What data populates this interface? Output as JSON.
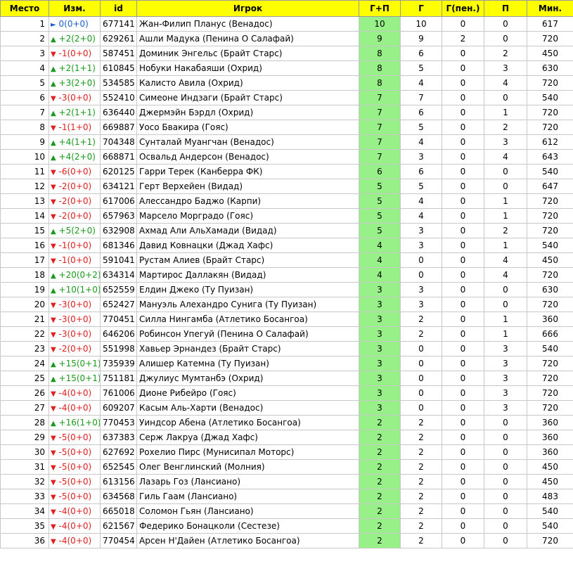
{
  "header": {
    "place": "Место",
    "change": "Изм.",
    "id": "id",
    "player": "Игрок",
    "gp": "Г+П",
    "g": "Г",
    "gpen": "Г(пен.)",
    "p": "П",
    "min": "Мин."
  },
  "colors": {
    "header_bg": "#ffff00",
    "gp_bg": "#98f088",
    "up": "#1a9a1a",
    "down": "#e02020",
    "same": "#1a5fd0"
  },
  "rows": [
    {
      "place": "1",
      "dir": "same",
      "arrow": "►",
      "change": "0(0+0)",
      "id": "677141",
      "player": "Жан-Филип Планус (Венадос)",
      "gp": "10",
      "g": "10",
      "gpen": "0",
      "p": "0",
      "min": "617"
    },
    {
      "place": "2",
      "dir": "up",
      "arrow": "▲",
      "change": "+2(2+0)",
      "id": "629261",
      "player": "Ашли Мадука (Пенина О Салафай)",
      "gp": "9",
      "g": "9",
      "gpen": "2",
      "p": "0",
      "min": "720"
    },
    {
      "place": "3",
      "dir": "down",
      "arrow": "▼",
      "change": "-1(0+0)",
      "id": "587451",
      "player": "Доминик Энгельс (Брайт Старс)",
      "gp": "8",
      "g": "6",
      "gpen": "0",
      "p": "2",
      "min": "450"
    },
    {
      "place": "4",
      "dir": "up",
      "arrow": "▲",
      "change": "+2(1+1)",
      "id": "610845",
      "player": "Нобуки Накабаяши (Охрид)",
      "gp": "8",
      "g": "5",
      "gpen": "0",
      "p": "3",
      "min": "630"
    },
    {
      "place": "5",
      "dir": "up",
      "arrow": "▲",
      "change": "+3(2+0)",
      "id": "534585",
      "player": "Калисто Авила (Охрид)",
      "gp": "8",
      "g": "4",
      "gpen": "0",
      "p": "4",
      "min": "720"
    },
    {
      "place": "6",
      "dir": "down",
      "arrow": "▼",
      "change": "-3(0+0)",
      "id": "552410",
      "player": "Симеоне Индзаги (Брайт Старс)",
      "gp": "7",
      "g": "7",
      "gpen": "0",
      "p": "0",
      "min": "540"
    },
    {
      "place": "7",
      "dir": "up",
      "arrow": "▲",
      "change": "+2(1+1)",
      "id": "636440",
      "player": "Джермэйн Бэрдл (Охрид)",
      "gp": "7",
      "g": "6",
      "gpen": "0",
      "p": "1",
      "min": "720"
    },
    {
      "place": "8",
      "dir": "down",
      "arrow": "▼",
      "change": "-1(1+0)",
      "id": "669887",
      "player": "Уосо Бвакира (Гояс)",
      "gp": "7",
      "g": "5",
      "gpen": "0",
      "p": "2",
      "min": "720"
    },
    {
      "place": "9",
      "dir": "up",
      "arrow": "▲",
      "change": "+4(1+1)",
      "id": "704348",
      "player": "Сунталай Муангчан (Венадос)",
      "gp": "7",
      "g": "4",
      "gpen": "0",
      "p": "3",
      "min": "612"
    },
    {
      "place": "10",
      "dir": "up",
      "arrow": "▲",
      "change": "+4(2+0)",
      "id": "668871",
      "player": "Освальд Андерсон (Венадос)",
      "gp": "7",
      "g": "3",
      "gpen": "0",
      "p": "4",
      "min": "643"
    },
    {
      "place": "11",
      "dir": "down",
      "arrow": "▼",
      "change": "-6(0+0)",
      "id": "620125",
      "player": "Гарри Терек (Канберра ФК)",
      "gp": "6",
      "g": "6",
      "gpen": "0",
      "p": "0",
      "min": "540"
    },
    {
      "place": "12",
      "dir": "down",
      "arrow": "▼",
      "change": "-2(0+0)",
      "id": "634121",
      "player": "Герт Верхейен (Видад)",
      "gp": "5",
      "g": "5",
      "gpen": "0",
      "p": "0",
      "min": "647"
    },
    {
      "place": "13",
      "dir": "down",
      "arrow": "▼",
      "change": "-2(0+0)",
      "id": "617006",
      "player": "Алессандро Баджо (Карпи)",
      "gp": "5",
      "g": "4",
      "gpen": "0",
      "p": "1",
      "min": "720"
    },
    {
      "place": "14",
      "dir": "down",
      "arrow": "▼",
      "change": "-2(0+0)",
      "id": "657963",
      "player": "Марсело Морградо (Гояс)",
      "gp": "5",
      "g": "4",
      "gpen": "0",
      "p": "1",
      "min": "720"
    },
    {
      "place": "15",
      "dir": "up",
      "arrow": "▲",
      "change": "+5(2+0)",
      "id": "632908",
      "player": "Ахмад Али АльХамади (Видад)",
      "gp": "5",
      "g": "3",
      "gpen": "0",
      "p": "2",
      "min": "720"
    },
    {
      "place": "16",
      "dir": "down",
      "arrow": "▼",
      "change": "-1(0+0)",
      "id": "681346",
      "player": "Давид Ковнацки (Джад Хафс)",
      "gp": "4",
      "g": "3",
      "gpen": "0",
      "p": "1",
      "min": "540"
    },
    {
      "place": "17",
      "dir": "down",
      "arrow": "▼",
      "change": "-1(0+0)",
      "id": "591041",
      "player": "Рустам Алиев (Брайт Старс)",
      "gp": "4",
      "g": "0",
      "gpen": "0",
      "p": "4",
      "min": "450"
    },
    {
      "place": "18",
      "dir": "up",
      "arrow": "▲",
      "change": "+20(0+2)",
      "id": "634314",
      "player": "Мартирос Даллакян (Видад)",
      "gp": "4",
      "g": "0",
      "gpen": "0",
      "p": "4",
      "min": "720"
    },
    {
      "place": "19",
      "dir": "up",
      "arrow": "▲",
      "change": "+10(1+0)",
      "id": "652559",
      "player": "Елдин Джеко (Ту Пуизан)",
      "gp": "3",
      "g": "3",
      "gpen": "0",
      "p": "0",
      "min": "630"
    },
    {
      "place": "20",
      "dir": "down",
      "arrow": "▼",
      "change": "-3(0+0)",
      "id": "652427",
      "player": "Мануэль Алехандро Сунига (Ту Пуизан)",
      "gp": "3",
      "g": "3",
      "gpen": "0",
      "p": "0",
      "min": "720"
    },
    {
      "place": "21",
      "dir": "down",
      "arrow": "▼",
      "change": "-3(0+0)",
      "id": "770451",
      "player": "Силла Нингамба (Атлетико Босангоа)",
      "gp": "3",
      "g": "2",
      "gpen": "0",
      "p": "1",
      "min": "360"
    },
    {
      "place": "22",
      "dir": "down",
      "arrow": "▼",
      "change": "-3(0+0)",
      "id": "646206",
      "player": "Робинсон Упегуй (Пенина О Салафай)",
      "gp": "3",
      "g": "2",
      "gpen": "0",
      "p": "1",
      "min": "666"
    },
    {
      "place": "23",
      "dir": "down",
      "arrow": "▼",
      "change": "-2(0+0)",
      "id": "551998",
      "player": "Хавьер Эрнандез (Брайт Старс)",
      "gp": "3",
      "g": "0",
      "gpen": "0",
      "p": "3",
      "min": "540"
    },
    {
      "place": "24",
      "dir": "up",
      "arrow": "▲",
      "change": "+15(0+1)",
      "id": "735939",
      "player": "Алишер Катемна (Ту Пуизан)",
      "gp": "3",
      "g": "0",
      "gpen": "0",
      "p": "3",
      "min": "720"
    },
    {
      "place": "25",
      "dir": "up",
      "arrow": "▲",
      "change": "+15(0+1)",
      "id": "751181",
      "player": "Джулиус Мумтанбэ (Охрид)",
      "gp": "3",
      "g": "0",
      "gpen": "0",
      "p": "3",
      "min": "720"
    },
    {
      "place": "26",
      "dir": "down",
      "arrow": "▼",
      "change": "-4(0+0)",
      "id": "761006",
      "player": "Дионе Рибейро (Гояс)",
      "gp": "3",
      "g": "0",
      "gpen": "0",
      "p": "3",
      "min": "720"
    },
    {
      "place": "27",
      "dir": "down",
      "arrow": "▼",
      "change": "-4(0+0)",
      "id": "609207",
      "player": "Касым Аль-Харти (Венадос)",
      "gp": "3",
      "g": "0",
      "gpen": "0",
      "p": "3",
      "min": "720"
    },
    {
      "place": "28",
      "dir": "up",
      "arrow": "▲",
      "change": "+16(1+0)",
      "id": "770453",
      "player": "Уиндсор Абена (Атлетико Босангоа)",
      "gp": "2",
      "g": "2",
      "gpen": "0",
      "p": "0",
      "min": "360"
    },
    {
      "place": "29",
      "dir": "down",
      "arrow": "▼",
      "change": "-5(0+0)",
      "id": "637383",
      "player": "Серж Лакруа (Джад Хафс)",
      "gp": "2",
      "g": "2",
      "gpen": "0",
      "p": "0",
      "min": "360"
    },
    {
      "place": "30",
      "dir": "down",
      "arrow": "▼",
      "change": "-5(0+0)",
      "id": "627692",
      "player": "Рохелио Пирс (Мунисипал Моторс)",
      "gp": "2",
      "g": "2",
      "gpen": "0",
      "p": "0",
      "min": "360"
    },
    {
      "place": "31",
      "dir": "down",
      "arrow": "▼",
      "change": "-5(0+0)",
      "id": "652545",
      "player": "Олег Венглинский (Молния)",
      "gp": "2",
      "g": "2",
      "gpen": "0",
      "p": "0",
      "min": "450"
    },
    {
      "place": "32",
      "dir": "down",
      "arrow": "▼",
      "change": "-5(0+0)",
      "id": "613156",
      "player": "Лазарь Гоз (Лансиано)",
      "gp": "2",
      "g": "2",
      "gpen": "0",
      "p": "0",
      "min": "450"
    },
    {
      "place": "33",
      "dir": "down",
      "arrow": "▼",
      "change": "-5(0+0)",
      "id": "634568",
      "player": "Гиль Гаам (Лансиано)",
      "gp": "2",
      "g": "2",
      "gpen": "0",
      "p": "0",
      "min": "483"
    },
    {
      "place": "34",
      "dir": "down",
      "arrow": "▼",
      "change": "-4(0+0)",
      "id": "665018",
      "player": "Соломон Гьян (Лансиано)",
      "gp": "2",
      "g": "2",
      "gpen": "0",
      "p": "0",
      "min": "540"
    },
    {
      "place": "35",
      "dir": "down",
      "arrow": "▼",
      "change": "-4(0+0)",
      "id": "621567",
      "player": "Федерико Бонацколи (Сестезе)",
      "gp": "2",
      "g": "2",
      "gpen": "0",
      "p": "0",
      "min": "540"
    },
    {
      "place": "36",
      "dir": "down",
      "arrow": "▼",
      "change": "-4(0+0)",
      "id": "770454",
      "player": "Арсен Н'Дайен (Атлетико Босангоа)",
      "gp": "2",
      "g": "2",
      "gpen": "0",
      "p": "0",
      "min": "720"
    }
  ]
}
